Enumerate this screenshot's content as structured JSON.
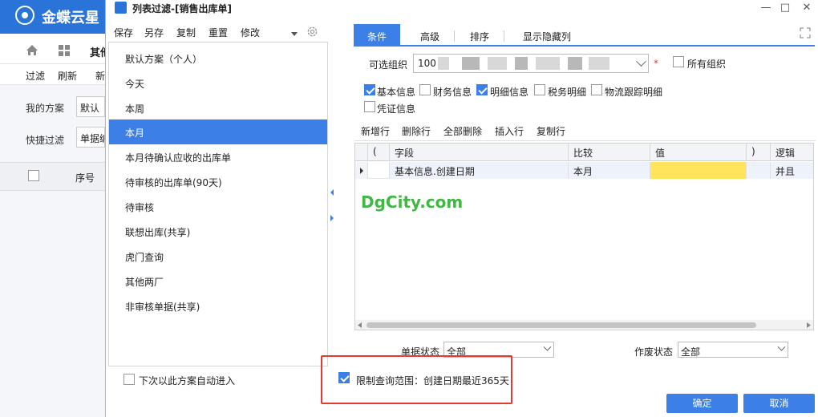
{
  "background_app": {
    "brand": "金蝶云星",
    "tab_label": "其他",
    "toolbar": [
      "过滤",
      "刷新",
      "新"
    ],
    "my_scheme_label": "我的方案",
    "my_scheme_value": "默认",
    "quick_filter_label": "快捷过滤",
    "quick_filter_value": "单据编",
    "grid_seq_header": "序号"
  },
  "dialog": {
    "title": "列表过滤-[销售出库单]",
    "window_buttons": [
      "—",
      "□",
      "✕"
    ]
  },
  "left_panel": {
    "toolbar": [
      "保存",
      "另存",
      "复制",
      "重置",
      "修改"
    ],
    "schemes": [
      {
        "label": "默认方案（个人）",
        "active": false
      },
      {
        "label": "今天",
        "active": false
      },
      {
        "label": "本周",
        "active": false
      },
      {
        "label": "本月",
        "active": true
      },
      {
        "label": "本月待确认应收的出库单",
        "active": false
      },
      {
        "label": "待审核的出库单(90天)",
        "active": false
      },
      {
        "label": "待审核",
        "active": false
      },
      {
        "label": "联想出库(共享)",
        "active": false
      },
      {
        "label": "虎门查询",
        "active": false
      },
      {
        "label": "其他两厂",
        "active": false
      },
      {
        "label": "非审核单据(共享)",
        "active": false
      }
    ],
    "auto_enter_label": "下次以此方案自动进入",
    "auto_enter_checked": false
  },
  "right_panel": {
    "tabs": [
      "条件",
      "高级",
      "排序",
      "显示隐藏列"
    ],
    "active_tab": 0,
    "org_label": "可选组织",
    "org_value": "100",
    "all_org_label": "所有组织",
    "all_org_checked": false,
    "info_options": [
      {
        "label": "基本信息",
        "checked": true
      },
      {
        "label": "财务信息",
        "checked": false
      },
      {
        "label": "明细信息",
        "checked": true
      },
      {
        "label": "税务明细",
        "checked": false
      },
      {
        "label": "物流跟踪明细",
        "checked": false
      },
      {
        "label": "凭证信息",
        "checked": false
      }
    ],
    "grid_toolbar": [
      "新增行",
      "删除行",
      "全部删除",
      "插入行",
      "复制行"
    ],
    "grid_columns": [
      "(",
      "字段",
      "比较",
      "值",
      ")",
      "逻辑"
    ],
    "grid_rows": [
      {
        "paren_open": "",
        "field": "基本信息.创建日期",
        "compare": "本月",
        "value": "",
        "paren_close": "",
        "logic": "并且"
      }
    ],
    "doc_status_label": "单据状态",
    "doc_status_value": "全部",
    "void_status_label": "作废状态",
    "void_status_value": "全部"
  },
  "footer": {
    "limit_label": "限制查询范围：创建日期最近365天",
    "limit_checked": true,
    "ok_label": "确定",
    "cancel_label": "取消"
  },
  "watermark": "DgCity.com",
  "colors": {
    "accent": "#3c7fe6",
    "header_blue": "#2a74d9",
    "highlight_yellow": "#ffe45c",
    "annotation_red": "#e53935",
    "watermark_green": "#3fb846"
  }
}
